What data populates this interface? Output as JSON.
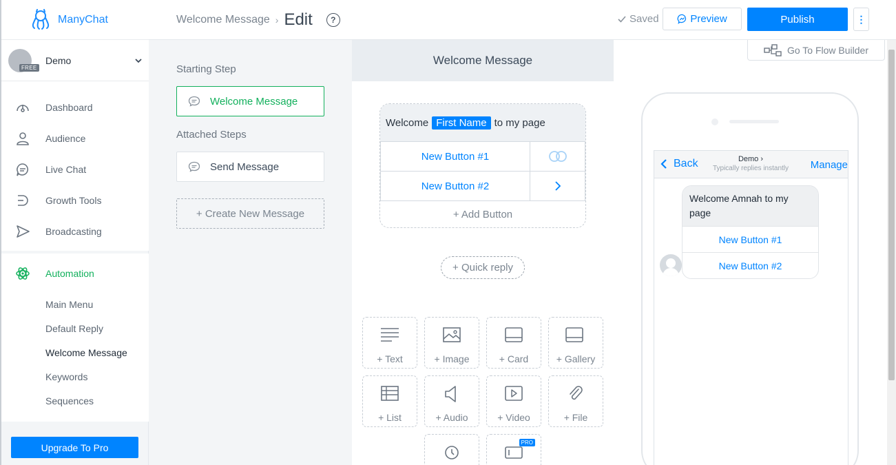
{
  "brand": {
    "name": "ManyChat"
  },
  "account": {
    "name": "Demo",
    "badge": "FREE"
  },
  "nav": {
    "items": [
      {
        "label": "Dashboard",
        "icon": "dashboard-icon"
      },
      {
        "label": "Audience",
        "icon": "audience-icon"
      },
      {
        "label": "Live Chat",
        "icon": "live-chat-icon"
      },
      {
        "label": "Growth Tools",
        "icon": "growth-tools-icon"
      },
      {
        "label": "Broadcasting",
        "icon": "broadcasting-icon"
      }
    ],
    "automation": {
      "label": "Automation",
      "sub_items": [
        "Main Menu",
        "Default Reply",
        "Welcome Message",
        "Keywords",
        "Sequences"
      ],
      "active_sub": "Welcome Message"
    },
    "upgrade_label": "Upgrade To Pro"
  },
  "header": {
    "breadcrumb_parent": "Welcome Message",
    "breadcrumb_current": "Edit",
    "help": "?",
    "saved_label": "Saved",
    "preview_label": "Preview",
    "publish_label": "Publish"
  },
  "steps": {
    "starting_title": "Starting Step",
    "starting_step": "Welcome Message",
    "attached_title": "Attached Steps",
    "attached_step": "Send Message",
    "create_label": "+ Create New Message"
  },
  "editor": {
    "title": "Welcome Message",
    "message_before": "Welcome",
    "variable": "First Name",
    "message_after": "to my page",
    "buttons": [
      "New Button #1",
      "New Button #2"
    ],
    "add_button": "+ Add Button",
    "quick_reply": "+ Quick reply",
    "tiles": [
      "+ Text",
      "+ Image",
      "+ Card",
      "+ Gallery",
      "+ List",
      "+ Audio",
      "+ Video",
      "+ File"
    ],
    "pro_badge": "PRO"
  },
  "preview": {
    "flow_builder_label": "Go To Flow Builder",
    "back_label": "Back",
    "page_name": "Demo",
    "reply_status": "Typically replies instantly",
    "manage_label": "Manage",
    "bubble_text": "Welcome Amnah to my page",
    "bubble_buttons": [
      "New Button #1",
      "New Button #2"
    ]
  },
  "colors": {
    "accent": "#0084ff",
    "active_green": "#12b05c"
  }
}
